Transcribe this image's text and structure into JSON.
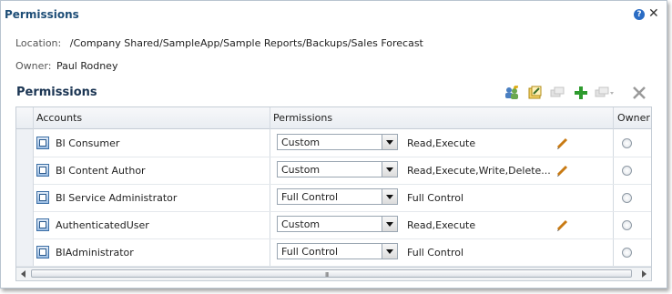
{
  "dialog": {
    "title": "Permissions",
    "help_icon": "help-icon",
    "close_icon": "close-icon"
  },
  "location": {
    "label": "Location:",
    "value": "/Company Shared/SampleApp/Sample Reports/Backups/Sales Forecast"
  },
  "owner": {
    "label": "Owner:",
    "value": "Paul Rodney"
  },
  "section_title": "Permissions",
  "toolbar_icons": [
    "add-users-roles-icon",
    "edit-icon",
    "copy-icon",
    "add-icon",
    "menu-icon",
    "delete-icon"
  ],
  "table": {
    "headers": {
      "accounts": "Accounts",
      "permissions": "Permissions",
      "owner": "Owner"
    },
    "rows": [
      {
        "account": "BI Consumer",
        "permission": "Custom",
        "detail": "Read,Execute",
        "editable": true
      },
      {
        "account": "BI Content Author",
        "permission": "Custom",
        "detail": "Read,Execute,Write,Delete...",
        "editable": true
      },
      {
        "account": "BI Service Administrator",
        "permission": "Full Control",
        "detail": "Full Control",
        "editable": false
      },
      {
        "account": "AuthenticatedUser",
        "permission": "Custom",
        "detail": "Read,Execute",
        "editable": true
      },
      {
        "account": "BIAdministrator",
        "permission": "Full Control",
        "detail": "Full Control",
        "editable": false
      }
    ]
  },
  "scroll_grip": "III",
  "colors": {
    "title": "#1e4e77",
    "accent": "#2a6cc4"
  }
}
